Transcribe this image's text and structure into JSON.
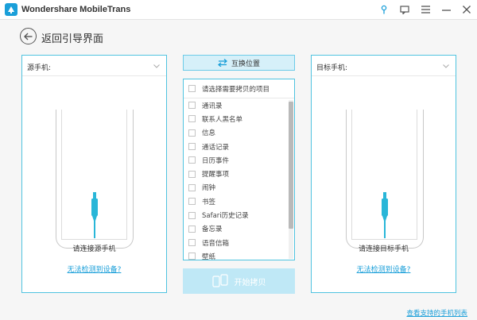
{
  "app": {
    "title": "Wondershare MobileTrans"
  },
  "titlebar_icons": [
    "pin-icon",
    "feedback-icon",
    "menu-icon",
    "minimize-icon",
    "close-icon"
  ],
  "nav": {
    "back_label": "返回引导界面"
  },
  "source_panel": {
    "header": "源手机:",
    "connect_label": "请连接源手机",
    "detect_link": "无法检测到设备?"
  },
  "target_panel": {
    "header": "目标手机:",
    "connect_label": "请连接目标手机",
    "detect_link": "无法检测到设备?"
  },
  "swap": {
    "label": "互换位置"
  },
  "content_list": {
    "header": "请选择需要拷贝的项目",
    "items": [
      "通讯录",
      "联系人黑名单",
      "信息",
      "通话记录",
      "日历事件",
      "提醒事项",
      "闹钟",
      "书签",
      "Safari历史记录",
      "备忘录",
      "语音信箱",
      "壁纸"
    ]
  },
  "start": {
    "label": "开始拷贝"
  },
  "footer": {
    "link": "查看支持的手机列表"
  },
  "colors": {
    "accent": "#1a9fd9",
    "border": "#4fc3e0",
    "cable": "#29b6d8"
  }
}
